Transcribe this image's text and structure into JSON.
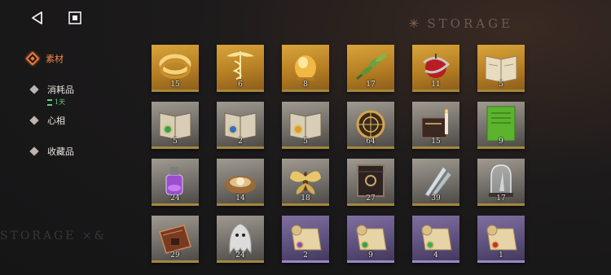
{
  "header": {
    "title": "STORAGE",
    "watermark": "STORAGE ×&"
  },
  "colors": {
    "accent": "#e9773a",
    "gold_slot": "#c08a2a",
    "grey_slot": "#8a857e",
    "purple_slot": "#6b5c8f",
    "timer": "#5fd08a"
  },
  "nav": {
    "back_icon": "back-arrow-icon",
    "home_icon": "stop-square-icon"
  },
  "sidebar": {
    "items": [
      {
        "label": "素材",
        "active": true
      },
      {
        "label": "消耗品",
        "sub": "1天"
      },
      {
        "label": "心相"
      },
      {
        "label": "收藏品"
      }
    ]
  },
  "items": [
    {
      "name": "golden-ring",
      "count": "15",
      "rarity": "gold"
    },
    {
      "name": "caduceus-charm",
      "count": "6",
      "rarity": "gold"
    },
    {
      "name": "amber-egg",
      "count": "8",
      "rarity": "gold"
    },
    {
      "name": "herb-branch",
      "count": "17",
      "rarity": "gold"
    },
    {
      "name": "serpent-apple",
      "count": "11",
      "rarity": "gold"
    },
    {
      "name": "open-book",
      "count": "5",
      "rarity": "gold"
    },
    {
      "name": "green-gem-book",
      "count": "5",
      "rarity": "grey"
    },
    {
      "name": "blue-gem-book",
      "count": "2",
      "rarity": "grey"
    },
    {
      "name": "amber-gem-book",
      "count": "5",
      "rarity": "grey"
    },
    {
      "name": "astrolabe",
      "count": "64",
      "rarity": "grey"
    },
    {
      "name": "candle-tome",
      "count": "15",
      "rarity": "grey"
    },
    {
      "name": "green-manuscript",
      "count": "9",
      "rarity": "grey"
    },
    {
      "name": "purple-vial",
      "count": "24",
      "rarity": "grey"
    },
    {
      "name": "bird-nest",
      "count": "14",
      "rarity": "grey"
    },
    {
      "name": "golden-moth",
      "count": "18",
      "rarity": "grey"
    },
    {
      "name": "dark-grimoire",
      "count": "27",
      "rarity": "grey"
    },
    {
      "name": "silver-feathers",
      "count": "39",
      "rarity": "grey"
    },
    {
      "name": "bell-jar",
      "count": "17",
      "rarity": "grey"
    },
    {
      "name": "leather-case",
      "count": "29",
      "rarity": "grey"
    },
    {
      "name": "ghost-cloth",
      "count": "24",
      "rarity": "grey"
    },
    {
      "name": "scroll-purple-gem",
      "count": "2",
      "rarity": "purple"
    },
    {
      "name": "scroll-green-gem",
      "count": "9",
      "rarity": "purple"
    },
    {
      "name": "scroll-green-gem-2",
      "count": "4",
      "rarity": "purple"
    },
    {
      "name": "scroll-red-gem",
      "count": "1",
      "rarity": "purple"
    }
  ]
}
